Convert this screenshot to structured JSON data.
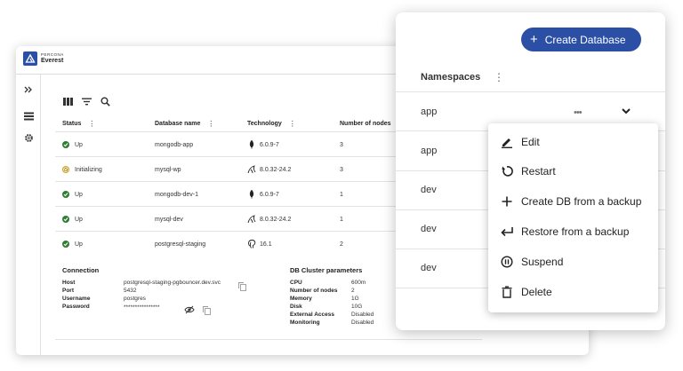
{
  "app": {
    "brand_line1": "PERCONA",
    "brand_line2": "Everest"
  },
  "table": {
    "columns": [
      "Status",
      "Database name",
      "Technology",
      "Number of nodes"
    ],
    "rows": [
      {
        "status": "Up",
        "name": "mongodb-app",
        "tech": "6.0.9-7",
        "tech_icon": "mongodb-leaf-icon",
        "nodes": "3"
      },
      {
        "status": "Initializing",
        "name": "mysql-wp",
        "tech": "8.0.32-24.2",
        "tech_icon": "mysql-dolphin-icon",
        "nodes": "3"
      },
      {
        "status": "Up",
        "name": "mongodb-dev-1",
        "tech": "6.0.9-7",
        "tech_icon": "mongodb-leaf-icon",
        "nodes": "1"
      },
      {
        "status": "Up",
        "name": "mysql-dev",
        "tech": "8.0.32-24.2",
        "tech_icon": "mysql-dolphin-icon",
        "nodes": "1"
      },
      {
        "status": "Up",
        "name": "postgresql-staging",
        "tech": "16.1",
        "tech_icon": "postgresql-elephant-icon",
        "nodes": "2"
      }
    ]
  },
  "details": {
    "connection_title": "Connection",
    "connection": [
      {
        "key": "Host",
        "value": "postgresql-staging-pgbouncer.dev.svc"
      },
      {
        "key": "Port",
        "value": "5432"
      },
      {
        "key": "Username",
        "value": "postgres"
      },
      {
        "key": "Password",
        "value": "****************"
      }
    ],
    "cluster_title": "DB Cluster parameters",
    "cluster": [
      {
        "key": "CPU",
        "value": "600m"
      },
      {
        "key": "Number of nodes",
        "value": "2"
      },
      {
        "key": "Memory",
        "value": "1G"
      },
      {
        "key": "Disk",
        "value": "10G"
      },
      {
        "key": "External Access",
        "value": "Disabled"
      },
      {
        "key": "Monitoring",
        "value": "Disabled"
      }
    ]
  },
  "panel": {
    "create_label": "Create Database",
    "namespaces_header": "Namespaces",
    "namespaces": [
      "app",
      "app",
      "dev",
      "dev",
      "dev"
    ]
  },
  "menu": {
    "items": [
      "Edit",
      "Restart",
      "Create DB from a backup",
      "Restore from a backup",
      "Suspend",
      "Delete"
    ]
  },
  "colors": {
    "accent": "#2c4fa6",
    "status_up": "#2e7d32",
    "status_init": "#c9a227"
  }
}
